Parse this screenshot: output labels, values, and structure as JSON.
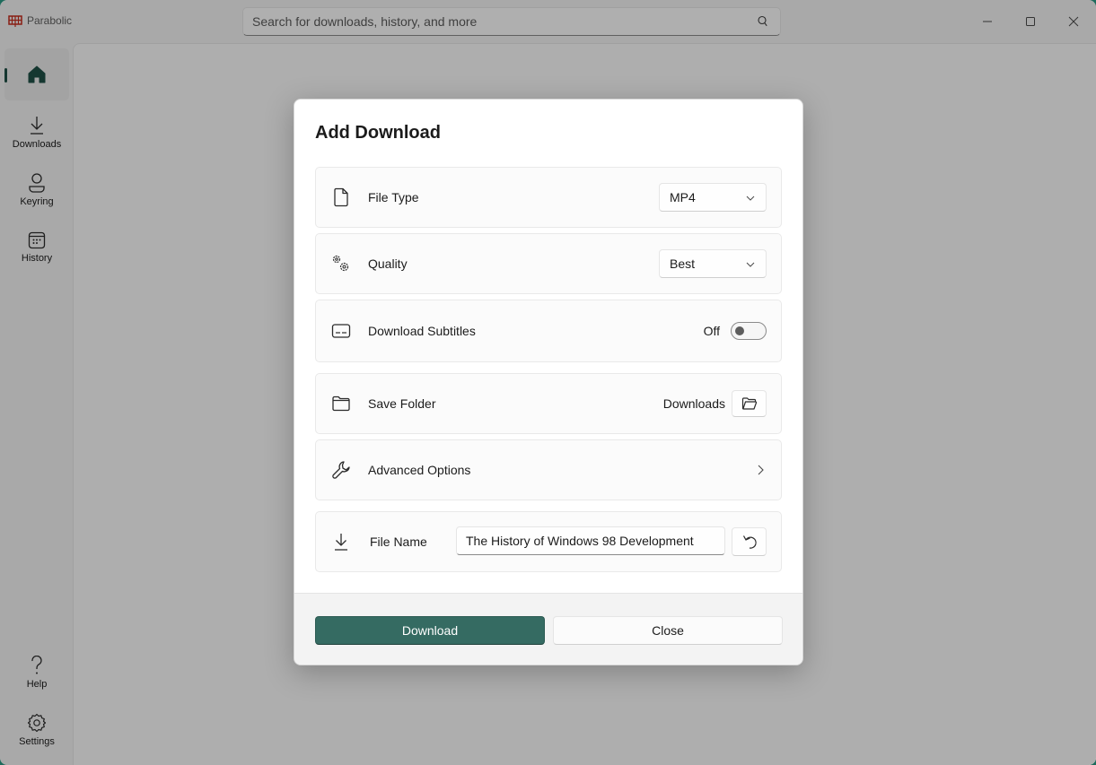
{
  "app": {
    "title": "Parabolic",
    "logo_color": "#c42b1c",
    "accent_color": "#356b62"
  },
  "search": {
    "placeholder": "Search for downloads, history, and more",
    "icon": "search-icon"
  },
  "window_controls": {
    "minimize": "minimize-icon",
    "maximize": "maximize-icon",
    "close": "close-icon"
  },
  "sidebar": {
    "items": [
      {
        "id": "home",
        "label": "",
        "icon": "home-icon",
        "active": true
      },
      {
        "id": "downloads",
        "label": "Downloads",
        "icon": "download-icon"
      },
      {
        "id": "keyring",
        "label": "Keyring",
        "icon": "person-icon"
      },
      {
        "id": "history",
        "label": "History",
        "icon": "calendar-icon"
      }
    ],
    "footer_items": [
      {
        "id": "help",
        "label": "Help",
        "icon": "question-icon"
      },
      {
        "id": "settings",
        "label": "Settings",
        "icon": "gear-icon"
      }
    ]
  },
  "dialog": {
    "title": "Add Download",
    "rows": {
      "file_type": {
        "label": "File Type",
        "value": "MP4",
        "icon": "document-icon"
      },
      "quality": {
        "label": "Quality",
        "value": "Best",
        "icon": "gears-icon"
      },
      "subtitles": {
        "label": "Download Subtitles",
        "state_label": "Off",
        "enabled": false,
        "icon": "subtitles-icon"
      },
      "save_folder": {
        "label": "Save Folder",
        "value": "Downloads",
        "icon": "folder-icon"
      },
      "advanced": {
        "label": "Advanced Options",
        "icon": "wrench-icon"
      },
      "file_name": {
        "label": "File Name",
        "value": "The History of Windows 98 Development",
        "icon": "download-icon"
      }
    },
    "buttons": {
      "primary": "Download",
      "secondary": "Close"
    }
  }
}
